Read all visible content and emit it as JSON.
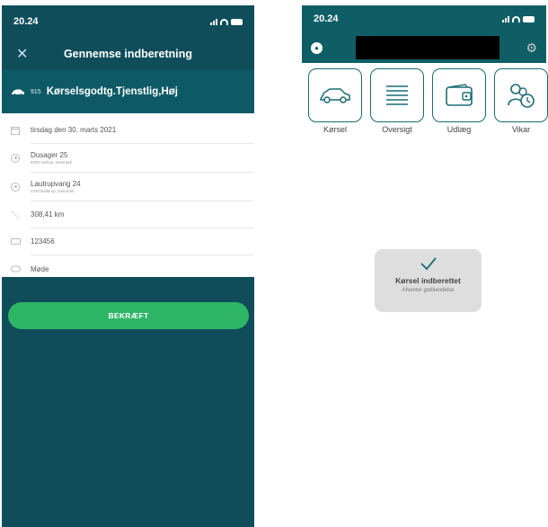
{
  "left": {
    "status_time": "20.24",
    "title": "Gennemse indberetning",
    "close_glyph": "✕",
    "trip_number": "915",
    "trip_name": "Kørselsgodtg.Tjenstlig,Høj",
    "date": "tirsdag den 30. marts 2021",
    "from_name": "Dusager 25",
    "from_addr": "8200 Aarhus, Danmark",
    "to_name": "Lautrupvang 24",
    "to_addr": "2750 Ballerup, Danmark",
    "distance": "308,41 km",
    "plate": "123456",
    "purpose": "Møde",
    "confirm_label": "BEKRÆFT"
  },
  "right": {
    "status_time": "20.24",
    "tiles": [
      {
        "label": "Kørsel",
        "icon": "car-icon"
      },
      {
        "label": "Oversigt",
        "icon": "list-icon"
      },
      {
        "label": "Udlæg",
        "icon": "wallet-icon"
      },
      {
        "label": "Vikar",
        "icon": "substitute-icon"
      }
    ],
    "toast_title": "Kørsel indberettet",
    "toast_sub": "Afventer godkendelse"
  },
  "colors": {
    "teal_dark": "#0f4d5a",
    "teal_header": "#0f5e66",
    "green_button": "#2eb566"
  }
}
